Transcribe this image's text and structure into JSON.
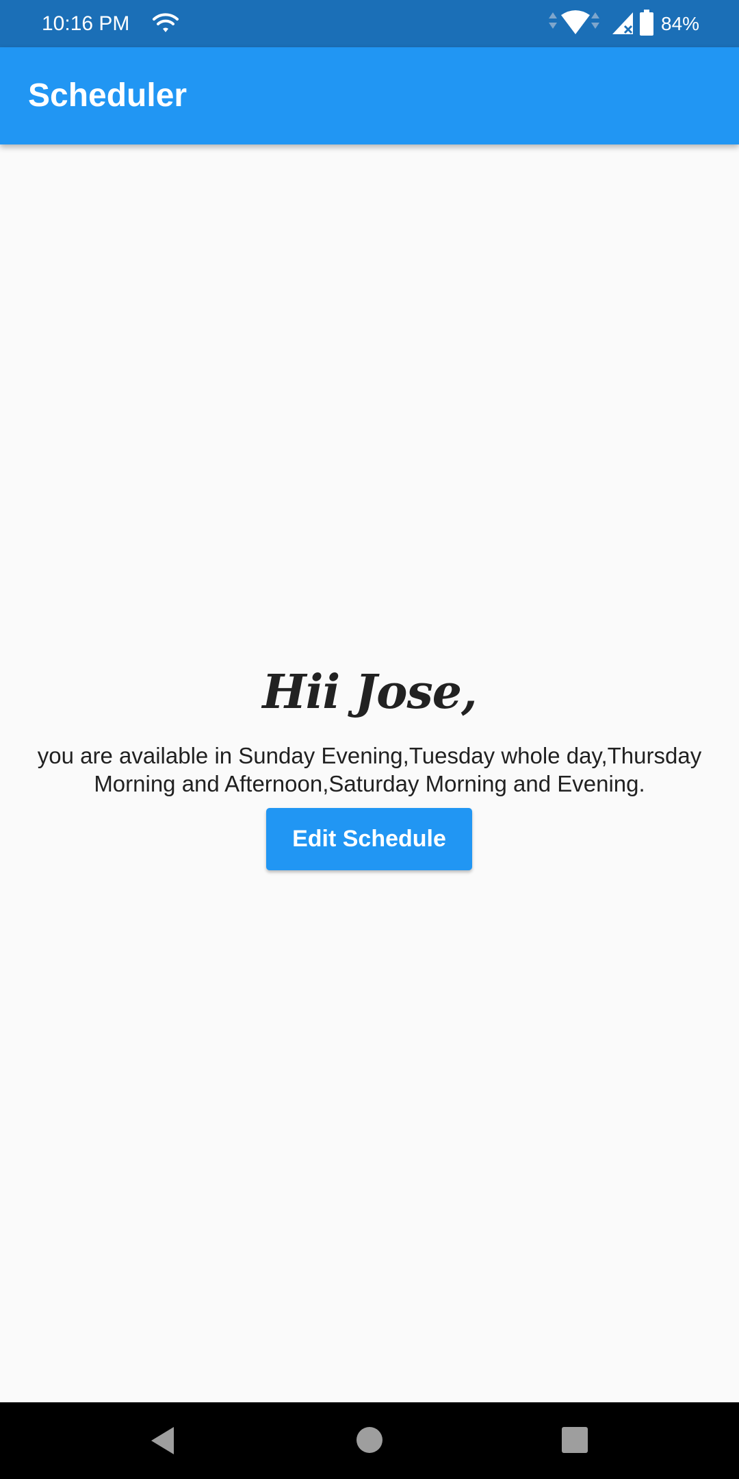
{
  "status_bar": {
    "time": "10:16 PM",
    "battery": "84%",
    "icons": [
      "wifi-icon",
      "data-arrows-icon",
      "wifi-icon",
      "signal-icon",
      "battery-icon"
    ]
  },
  "app_bar": {
    "title": "Scheduler"
  },
  "main": {
    "greeting": "Hii Jose,",
    "availability": "you are available in Sunday Evening,Tuesday whole day,Thursday Morning and Afternoon,Saturday Morning and Evening.",
    "edit_button_label": "Edit Schedule"
  },
  "nav_bar": {
    "icons": [
      "back-icon",
      "home-icon",
      "recent-apps-icon"
    ]
  },
  "colors": {
    "status_bar": "#1b6fb7",
    "app_bar": "#2196f3",
    "background": "#fafafa",
    "button": "#2196f3",
    "nav_bar": "#000000"
  }
}
